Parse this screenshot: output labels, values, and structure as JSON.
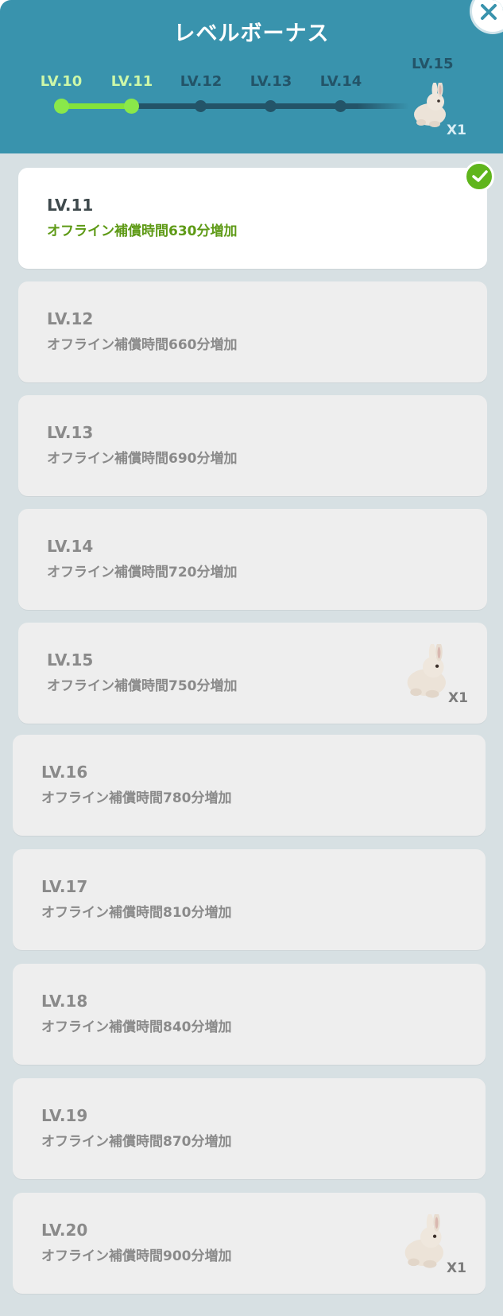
{
  "dialog": {
    "title": "レベルボーナス",
    "close_icon": "close-icon"
  },
  "progress": {
    "levels": [
      "LV.10",
      "LV.11",
      "LV.12",
      "LV.13",
      "LV.14"
    ],
    "completed": [
      "LV.10",
      "LV.11"
    ],
    "final_level": "LV.15",
    "final_reward_icon": "rabbit-icon",
    "final_reward_count": "X1",
    "colors": {
      "done": "#8ae84a",
      "pending": "#235468",
      "header": "#3993ad"
    }
  },
  "bonuses": [
    {
      "level": "LV.11",
      "text": "オフライン補償時間630分増加",
      "achieved": true,
      "reward_icon": null,
      "reward_count": null
    },
    {
      "level": "LV.12",
      "text": "オフライン補償時間660分増加",
      "achieved": false,
      "reward_icon": null,
      "reward_count": null
    },
    {
      "level": "LV.13",
      "text": "オフライン補償時間690分増加",
      "achieved": false,
      "reward_icon": null,
      "reward_count": null
    },
    {
      "level": "LV.14",
      "text": "オフライン補償時間720分増加",
      "achieved": false,
      "reward_icon": null,
      "reward_count": null
    },
    {
      "level": "LV.15",
      "text": "オフライン補償時間750分増加",
      "achieved": false,
      "reward_icon": "rabbit-icon",
      "reward_count": "X1"
    },
    {
      "level": "LV.16",
      "text": "オフライン補償時間780分増加",
      "achieved": false,
      "reward_icon": null,
      "reward_count": null
    },
    {
      "level": "LV.17",
      "text": "オフライン補償時間810分増加",
      "achieved": false,
      "reward_icon": null,
      "reward_count": null
    },
    {
      "level": "LV.18",
      "text": "オフライン補償時間840分増加",
      "achieved": false,
      "reward_icon": null,
      "reward_count": null
    },
    {
      "level": "LV.19",
      "text": "オフライン補償時間870分増加",
      "achieved": false,
      "reward_icon": null,
      "reward_count": null
    },
    {
      "level": "LV.20",
      "text": "オフライン補償時間900分増加",
      "achieved": false,
      "reward_icon": "rabbit-icon",
      "reward_count": "X1"
    }
  ]
}
